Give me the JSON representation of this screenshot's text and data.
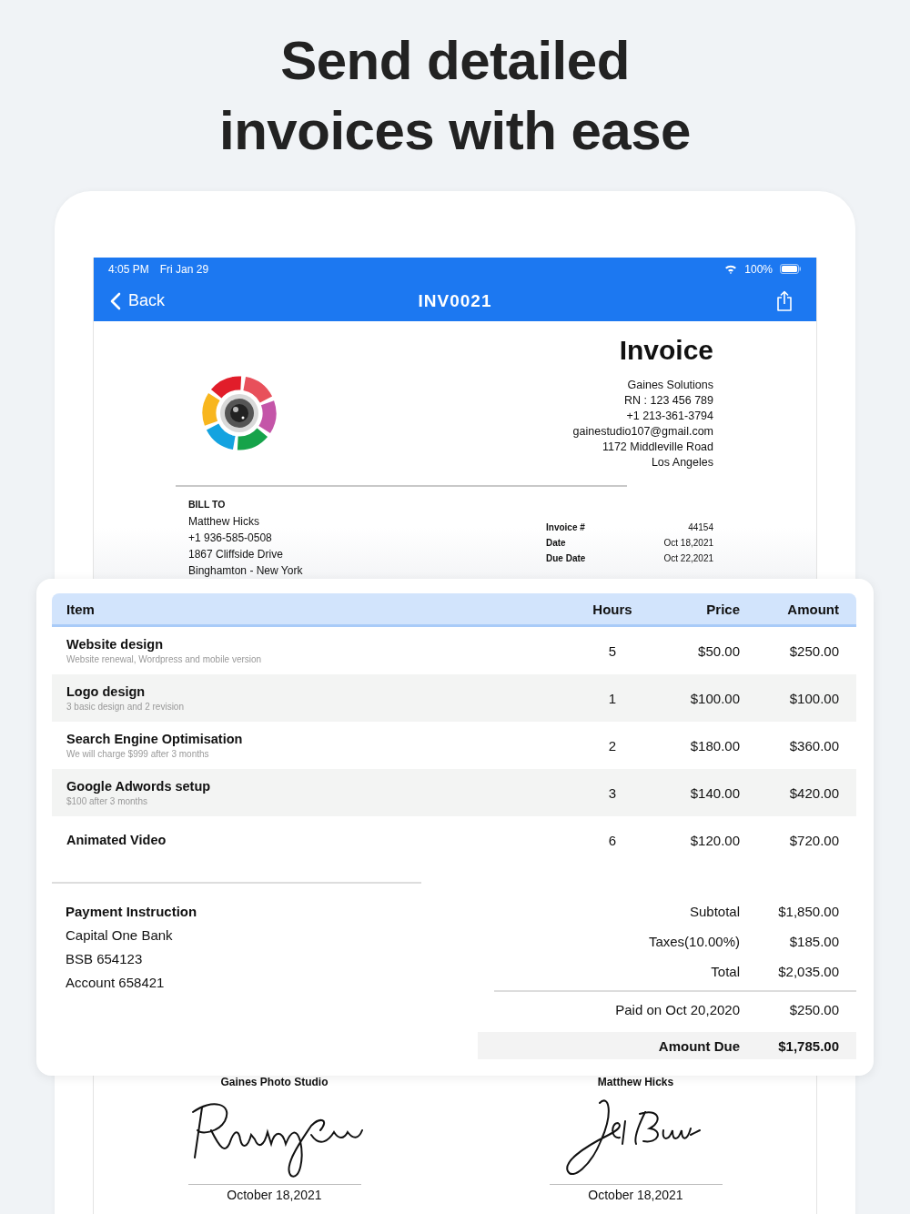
{
  "headline_lines": [
    "Send detailed",
    "invoices with ease"
  ],
  "status_bar": {
    "time": "4:05 PM",
    "date": "Fri Jan 29",
    "battery": "100%"
  },
  "nav": {
    "back": "Back",
    "title": "INV0021"
  },
  "invoice": {
    "title": "Invoice",
    "company_lines": [
      "Gaines Solutions",
      "RN : 123 456 789",
      "+1 213-361-3794",
      "gainestudio107@gmail.com",
      "1172 Middleville Road",
      "Los Angeles"
    ],
    "bill_to": {
      "label": "BILL TO",
      "lines": [
        "Matthew Hicks",
        "+1 936-585-0508",
        "1867 Cliffside Drive",
        "Binghamton - New York"
      ]
    },
    "meta": [
      {
        "label": "Invoice #",
        "value": "44154"
      },
      {
        "label": "Date",
        "value": "Oct 18,2021"
      },
      {
        "label": "Due Date",
        "value": "Oct 22,2021"
      }
    ]
  },
  "table": {
    "columns": [
      "Item",
      "Hours",
      "Price",
      "Amount"
    ],
    "rows": [
      {
        "name": "Website design",
        "description": "Website renewal, Wordpress and mobile  version",
        "hours": "5",
        "price": "$50.00",
        "amount": "$250.00"
      },
      {
        "name": "Logo design",
        "description": "3 basic design and 2 revision",
        "hours": "1",
        "price": "$100.00",
        "amount": "$100.00"
      },
      {
        "name": "Search Engine Optimisation",
        "description": "We will charge $999 after 3 months",
        "hours": "2",
        "price": "$180.00",
        "amount": "$360.00"
      },
      {
        "name": "Google Adwords setup",
        "description": "$100 after 3 months",
        "hours": "3",
        "price": "$140.00",
        "amount": "$420.00"
      },
      {
        "name": "Animated Video",
        "hours": "6",
        "price": "$120.00",
        "amount": "$720.00"
      }
    ]
  },
  "payment": {
    "title": "Payment Instruction",
    "lines": [
      "Capital One Bank",
      "BSB 654123",
      "Account 658421"
    ]
  },
  "totals": [
    {
      "kind": "line",
      "label": "Subtotal",
      "value": "$1,850.00"
    },
    {
      "kind": "line",
      "label": "Taxes(10.00%)",
      "value": "$185.00"
    },
    {
      "kind": "line",
      "label": "Total",
      "value": "$2,035.00"
    },
    {
      "kind": "paid",
      "label": "Paid on Oct 20,2020",
      "value": "$250.00"
    },
    {
      "kind": "due",
      "label": "Amount Due",
      "value": "$1,785.00"
    }
  ],
  "signatures": [
    {
      "name": "Gaines Photo Studio",
      "date": "October 18,2021"
    },
    {
      "name": "Matthew Hicks",
      "date": "October 18,2021"
    }
  ]
}
